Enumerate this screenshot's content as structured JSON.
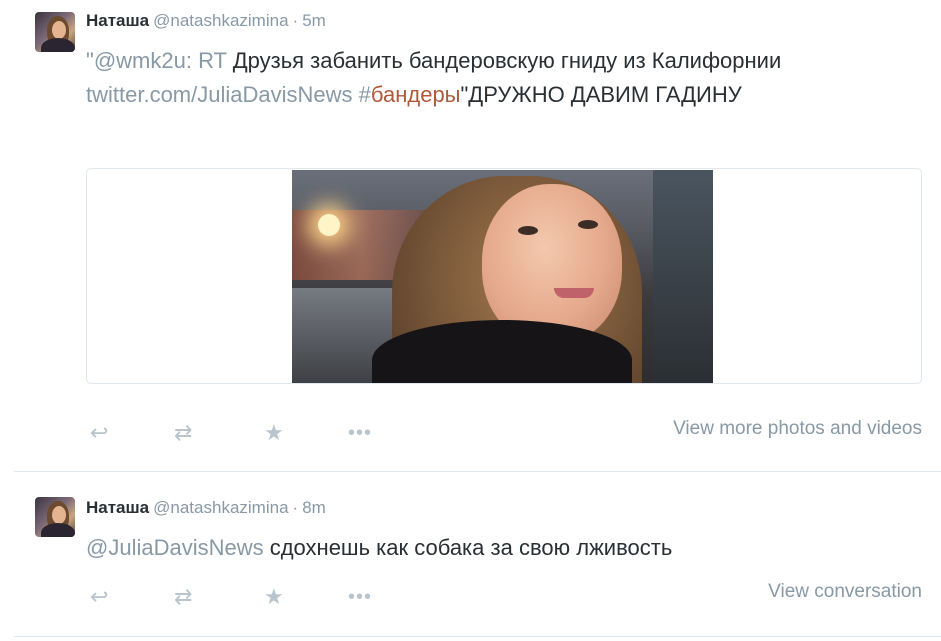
{
  "tweets": [
    {
      "author_name": "Наташа",
      "handle": "@natashkazimina",
      "separator": "·",
      "time": "5m",
      "text_prefix": "\"",
      "mention": "@wmk2u",
      "text_part1": ": RT ",
      "text_bold": "Друзья забанить бандеровскую гниду из Калифорнии",
      "link": "twitter.com/JuliaDavisNews",
      "hash_symbol": "#",
      "hashtag": "бандеры",
      "text_part2": "\"ДРУЖНО ДАВИМ ГАДИНУ",
      "action_link": "View more photos and videos"
    },
    {
      "author_name": "Наташа",
      "handle": "@natashkazimina",
      "separator": "·",
      "time": "8m",
      "mention": "@JuliaDavisNews",
      "text": " сдохнешь как собака за свою лживость",
      "action_link": "View conversation"
    }
  ],
  "icons": {
    "reply": "↩",
    "retweet": "⇄",
    "favorite": "★",
    "more": "•••"
  },
  "colors": {
    "text": "#292f33",
    "muted": "#8899a6",
    "hashtag": "#b0593a",
    "divider": "#e1e8ed"
  }
}
